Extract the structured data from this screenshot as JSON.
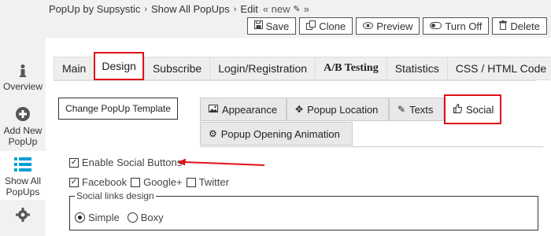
{
  "breadcrumb": {
    "items": [
      "PopUp by Supsystic",
      "Show All PopUps",
      "Edit"
    ],
    "current": "« new",
    "tail": "»",
    "pencil_icon": "pencil-icon"
  },
  "toolbar": {
    "save": "Save",
    "clone": "Clone",
    "preview": "Preview",
    "turn_off": "Turn Off",
    "delete": "Delete"
  },
  "sidebar": {
    "items": [
      {
        "label": "Overview",
        "icon": "info-icon"
      },
      {
        "label": "Add New PopUp",
        "icon": "plus-circle-icon"
      },
      {
        "label": "Show All PopUps",
        "icon": "list-icon"
      },
      {
        "label": "",
        "icon": "gear-icon"
      }
    ]
  },
  "main_tabs": [
    "Main",
    "Design",
    "Subscribe",
    "Login/Registration",
    "A/B Testing",
    "Statistics",
    "CSS / HTML Code"
  ],
  "main_tab_active": "Design",
  "template_button": "Change PopUp Template",
  "sub_tabs": [
    "Appearance",
    "Popup Location",
    "Texts",
    "Social",
    "Popup Opening Animation"
  ],
  "sub_tab_active": "Social",
  "options": {
    "enable_social": {
      "label": "Enable Social Buttons",
      "checked": true
    },
    "facebook": {
      "label": "Facebook",
      "checked": true
    },
    "google": {
      "label": "Google+",
      "checked": false
    },
    "twitter": {
      "label": "Twitter",
      "checked": false
    }
  },
  "social_links_design": {
    "legend": "Social links design",
    "options": [
      "Simple",
      "Boxy"
    ],
    "selected": "Simple"
  },
  "colors": {
    "highlight": "#e0101a",
    "accent_blue": "#00a0d2"
  }
}
